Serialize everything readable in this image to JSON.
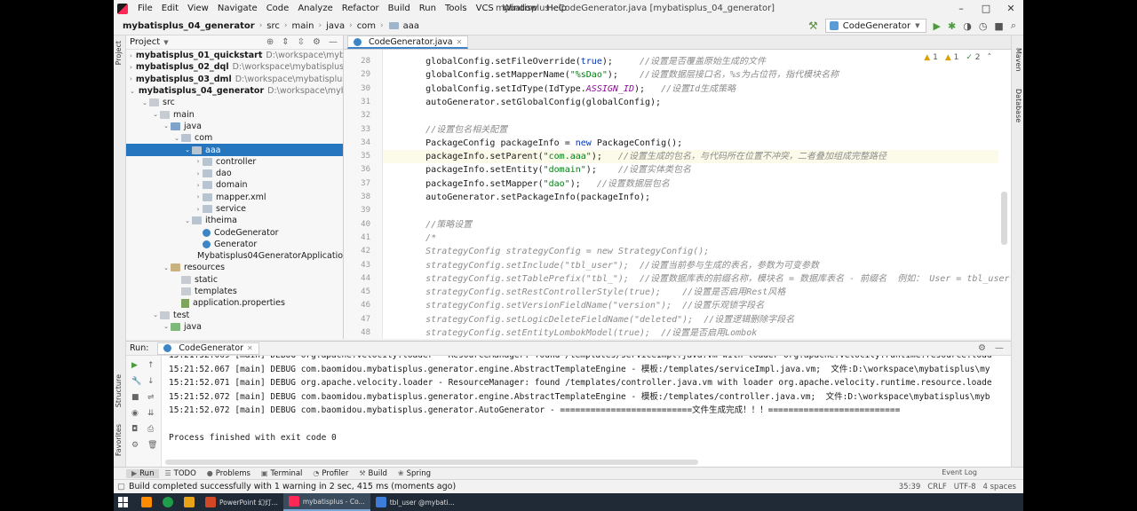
{
  "menu": [
    "File",
    "Edit",
    "View",
    "Navigate",
    "Code",
    "Analyze",
    "Refactor",
    "Build",
    "Run",
    "Tools",
    "VCS",
    "Window",
    "Help"
  ],
  "window_title": "mybatisplus - CodeGenerator.java [mybatisplus_04_generator]",
  "window_controls": {
    "minimize": "–",
    "maximize": "□",
    "close": "✕"
  },
  "breadcrumbs": [
    "mybatisplus_04_generator",
    "src",
    "main",
    "java",
    "com",
    "aaa"
  ],
  "run_config": "CodeGenerator",
  "left_tabs": {
    "project": "Project",
    "structure": "Structure",
    "favorites": "Favorites"
  },
  "right_tabs": {
    "maven": "Maven",
    "database": "Database"
  },
  "project_panel": {
    "title": "Project",
    "tree": [
      {
        "indent": 0,
        "arrow": "›",
        "icon": "mod",
        "label": "mybatisplus_01_quickstart",
        "path": "D:\\workspace\\mybatispl",
        "bold": true
      },
      {
        "indent": 0,
        "arrow": "›",
        "icon": "mod",
        "label": "mybatisplus_02_dql",
        "path": "D:\\workspace\\mybatisplus\\myb",
        "bold": true
      },
      {
        "indent": 0,
        "arrow": "›",
        "icon": "mod",
        "label": "mybatisplus_03_dml",
        "path": "D:\\workspace\\mybatisplus\\myb",
        "bold": true
      },
      {
        "indent": 0,
        "arrow": "⌄",
        "icon": "mod",
        "label": "mybatisplus_04_generator",
        "path": "D:\\workspace\\mybatispl",
        "bold": true
      },
      {
        "indent": 1,
        "arrow": "⌄",
        "icon": "plain",
        "label": "src"
      },
      {
        "indent": 2,
        "arrow": "⌄",
        "icon": "plain",
        "label": "main"
      },
      {
        "indent": 3,
        "arrow": "⌄",
        "icon": "src",
        "label": "java"
      },
      {
        "indent": 4,
        "arrow": "⌄",
        "icon": "pkg",
        "label": "com"
      },
      {
        "indent": 5,
        "arrow": "⌄",
        "icon": "pkg",
        "label": "aaa",
        "selected": true
      },
      {
        "indent": 6,
        "arrow": "›",
        "icon": "pkg",
        "label": "controller"
      },
      {
        "indent": 6,
        "arrow": "›",
        "icon": "pkg",
        "label": "dao"
      },
      {
        "indent": 6,
        "arrow": "›",
        "icon": "pkg",
        "label": "domain"
      },
      {
        "indent": 6,
        "arrow": "›",
        "icon": "pkg",
        "label": "mapper.xml"
      },
      {
        "indent": 6,
        "arrow": "›",
        "icon": "pkg",
        "label": "service"
      },
      {
        "indent": 5,
        "arrow": "⌄",
        "icon": "pkg",
        "label": "itheima"
      },
      {
        "indent": 6,
        "arrow": "",
        "icon": "class",
        "label": "CodeGenerator"
      },
      {
        "indent": 6,
        "arrow": "",
        "icon": "class",
        "label": "Generator"
      },
      {
        "indent": 6,
        "arrow": "",
        "icon": "class",
        "label": "Mybatisplus04GeneratorApplication"
      },
      {
        "indent": 3,
        "arrow": "⌄",
        "icon": "res",
        "label": "resources"
      },
      {
        "indent": 4,
        "arrow": "",
        "icon": "plain",
        "label": "static"
      },
      {
        "indent": 4,
        "arrow": "",
        "icon": "plain",
        "label": "templates"
      },
      {
        "indent": 4,
        "arrow": "",
        "icon": "props",
        "label": "application.properties"
      },
      {
        "indent": 2,
        "arrow": "⌄",
        "icon": "plain",
        "label": "test"
      },
      {
        "indent": 3,
        "arrow": "⌄",
        "icon": "test",
        "label": "java"
      }
    ]
  },
  "editor": {
    "tab": "CodeGenerator.java",
    "inspections": {
      "warnings": "1",
      "weak": "1",
      "typos": "2"
    },
    "lines": [
      {
        "n": "28",
        "code": "        globalConfig.setFileOverride(true);     ",
        "cmt": "//设置是否覆盖原始生成的文件"
      },
      {
        "n": "29",
        "code": "        globalConfig.setMapperName(\"%sDao\");    ",
        "cmt": "//设置数据层接口名，%s为占位符，指代模块名称"
      },
      {
        "n": "30",
        "code": "        globalConfig.setIdType(IdType.ASSIGN_ID);   ",
        "cmt": "//设置Id生成策略"
      },
      {
        "n": "31",
        "code": "        autoGenerator.setGlobalConfig(globalConfig);",
        "cmt": ""
      },
      {
        "n": "32",
        "code": "",
        "cmt": ""
      },
      {
        "n": "33",
        "code": "        ",
        "cmt": "//设置包名相关配置"
      },
      {
        "n": "34",
        "code": "        PackageConfig packageInfo = new PackageConfig();",
        "cmt": ""
      },
      {
        "n": "35",
        "code": "        packageInfo.setParent(\"com.aaa\");   ",
        "cmt": "//设置生成的包名，与代码所在位置不冲突，二者叠加组成完整路径",
        "hl": true
      },
      {
        "n": "36",
        "code": "        packageInfo.setEntity(\"domain\");    ",
        "cmt": "//设置实体类包名"
      },
      {
        "n": "37",
        "code": "        packageInfo.setMapper(\"dao\");   ",
        "cmt": "//设置数据层包名"
      },
      {
        "n": "38",
        "code": "        autoGenerator.setPackageInfo(packageInfo);",
        "cmt": ""
      },
      {
        "n": "39",
        "code": "",
        "cmt": ""
      },
      {
        "n": "40",
        "code": "        ",
        "cmt": "//策略设置"
      },
      {
        "n": "41",
        "code": "        ",
        "cmt": "/*"
      },
      {
        "n": "42",
        "code": "",
        "cmt": "        StrategyConfig strategyConfig = new StrategyConfig();"
      },
      {
        "n": "43",
        "code": "",
        "cmt": "        strategyConfig.setInclude(\"tbl_user\");  //设置当前参与生成的表名，参数为可变参数"
      },
      {
        "n": "44",
        "code": "",
        "cmt": "        strategyConfig.setTablePrefix(\"tbl_\");  //设置数据库表的前缀名称，模块名 = 数据库表名 - 前缀名  例如： User = tbl_user"
      },
      {
        "n": "45",
        "code": "",
        "cmt": "        strategyConfig.setRestControllerStyle(true);    //设置是否启用Rest风格"
      },
      {
        "n": "46",
        "code": "",
        "cmt": "        strategyConfig.setVersionFieldName(\"version\");  //设置乐观锁字段名"
      },
      {
        "n": "47",
        "code": "",
        "cmt": "        strategyConfig.setLogicDeleteFieldName(\"deleted\");  //设置逻辑删除字段名"
      },
      {
        "n": "48",
        "code": "",
        "cmt": "        strategyConfig.setEntityLombokModel(true);  //设置是否启用Lombok"
      }
    ]
  },
  "run_panel": {
    "label": "Run:",
    "tab": "CodeGenerator",
    "console": [
      "15:21:52.069 [main] DEBUG org.apache.velocity.loader - ResourceManager: found /templates/serviceImpl.java.vm with loader org.apache.velocity.runtime.resource.load",
      "15:21:52.067 [main] DEBUG com.baomidou.mybatisplus.generator.engine.AbstractTemplateEngine - 模板:/templates/serviceImpl.java.vm;  文件:D:\\workspace\\mybatisplus\\my",
      "15:21:52.071 [main] DEBUG org.apache.velocity.loader - ResourceManager: found /templates/controller.java.vm with loader org.apache.velocity.runtime.resource.loade",
      "15:21:52.072 [main] DEBUG com.baomidou.mybatisplus.generator.engine.AbstractTemplateEngine - 模板:/templates/controller.java.vm;  文件:D:\\workspace\\mybatisplus\\myb",
      "15:21:52.072 [main] DEBUG com.baomidou.mybatisplus.generator.AutoGenerator - ==========================文件生成完成！！！==========================",
      "",
      "Process finished with exit code 0"
    ]
  },
  "tool_windows": [
    {
      "label": "Run",
      "icon": "▶",
      "active": true
    },
    {
      "label": "TODO",
      "icon": "☰"
    },
    {
      "label": "Problems",
      "icon": "●"
    },
    {
      "label": "Terminal",
      "icon": "▣"
    },
    {
      "label": "Profiler",
      "icon": "◔"
    },
    {
      "label": "Build",
      "icon": "⚒"
    },
    {
      "label": "Spring",
      "icon": "❀"
    }
  ],
  "event_log": "Event Log",
  "status": {
    "message": "Build completed successfully with 1 warning in 2 sec, 415 ms (moments ago)",
    "position": "35:39",
    "line_sep": "CRLF",
    "encoding": "UTF-8",
    "indent": "4 spaces"
  },
  "taskbar": [
    {
      "label": "",
      "color": "#ff8c00"
    },
    {
      "label": "",
      "color": "#1e9e4a"
    },
    {
      "label": "",
      "color": "#e8a317"
    },
    {
      "label": "PowerPoint 幻灯...",
      "color": "#d24726"
    },
    {
      "label": "mybatisplus - Co...",
      "color": "#fe2857",
      "active": true
    },
    {
      "label": "tbl_user @mybati...",
      "color": "#3b7dd8"
    }
  ]
}
